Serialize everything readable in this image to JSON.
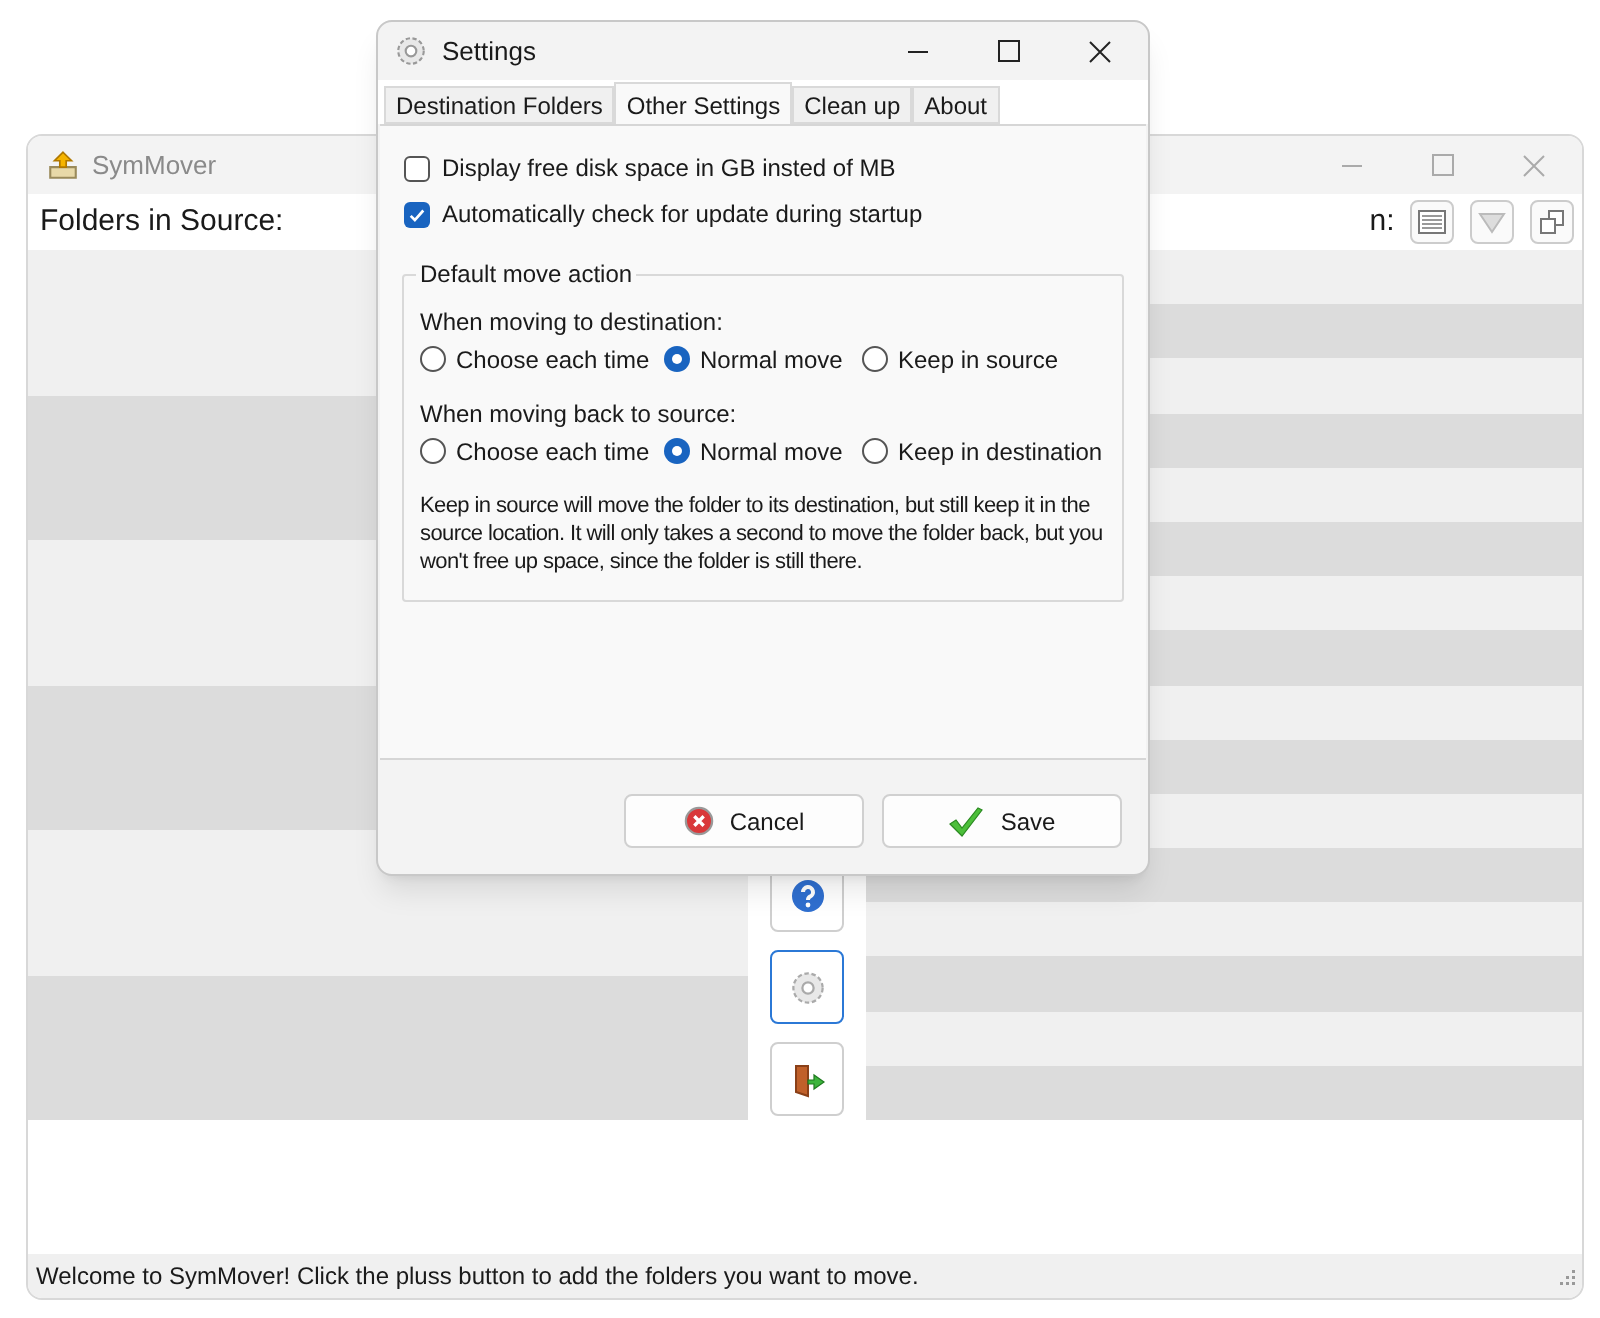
{
  "main_window": {
    "title": "SymMover",
    "source_header": "Folders in Source:",
    "destination_header": "n:",
    "status": "Welcome to SymMover! Click the pluss button to add the folders you want to move.",
    "side_buttons": [
      {
        "kind": "help",
        "selected": false
      },
      {
        "kind": "settings",
        "selected": true
      },
      {
        "kind": "exit",
        "selected": false
      }
    ]
  },
  "dialog": {
    "title": "Settings",
    "tabs": [
      {
        "label": "Destination Folders",
        "selected": false
      },
      {
        "label": "Other Settings",
        "selected": true
      },
      {
        "label": "Clean up",
        "selected": false
      },
      {
        "label": "About",
        "selected": false
      }
    ],
    "checkboxes": [
      {
        "label": "Display free disk space in GB insted of MB",
        "checked": false
      },
      {
        "label": "Automatically check for update during startup",
        "checked": true
      }
    ],
    "group": {
      "title": "Default move action",
      "sections": [
        {
          "label": "When moving to destination:",
          "options": [
            {
              "label": "Choose each time",
              "selected": false
            },
            {
              "label": "Normal move",
              "selected": true
            },
            {
              "label": "Keep in source",
              "selected": false
            }
          ]
        },
        {
          "label": "When moving back to source:",
          "options": [
            {
              "label": "Choose each time",
              "selected": false
            },
            {
              "label": "Normal move",
              "selected": true
            },
            {
              "label": "Keep in destination",
              "selected": false
            }
          ]
        }
      ],
      "note": "Keep in source will move the folder to its destination, but still keep it in the source location. It will only takes a second to move the folder back, but you won't free up space, since the folder is still there."
    },
    "buttons": [
      {
        "kind": "cancel",
        "label": "Cancel"
      },
      {
        "kind": "save",
        "label": "Save"
      }
    ]
  }
}
